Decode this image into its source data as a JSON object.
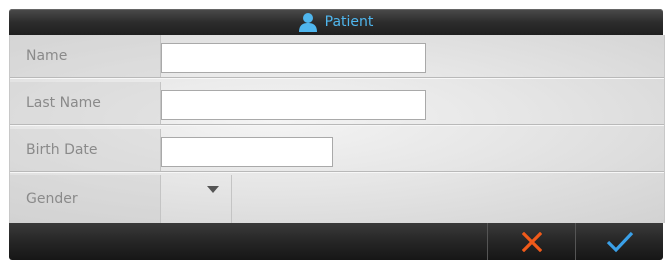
{
  "title": {
    "text": "Patient",
    "icon": "person-icon",
    "color": "#4fb6ee"
  },
  "form": {
    "fields": [
      {
        "label": "Name",
        "value": "",
        "placeholder": ""
      },
      {
        "label": "Last Name",
        "value": "",
        "placeholder": ""
      },
      {
        "label": "Birth Date",
        "value": "",
        "placeholder": ""
      },
      {
        "label": "Gender",
        "selected": ""
      }
    ]
  },
  "actions": {
    "cancel": {
      "icon": "close-icon",
      "color": "#f05a1a"
    },
    "confirm": {
      "icon": "checkmark-icon",
      "color": "#3aa0e8"
    }
  }
}
